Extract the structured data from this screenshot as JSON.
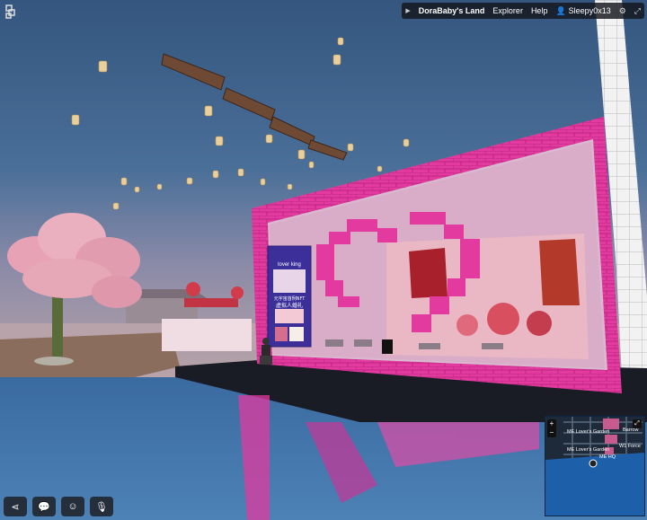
{
  "topbar": {
    "land_name": "DoraBaby's Land",
    "explorer_label": "Explorer",
    "help_label": "Help",
    "username": "Sleepy0x13"
  },
  "poster": {
    "line1": "lover king",
    "line2": "元宇宙首例NFT",
    "line3": "虚拟人婚礼"
  },
  "minimap": {
    "labels": [
      "ME Lover's Garden",
      "ME Lover's Garden",
      "ME HQ",
      "Barrow",
      "W1 Force"
    ]
  },
  "colors": {
    "sky_top": "#3a5b86",
    "sky_horizon": "#9c8fa8",
    "frame_pink": "#e0349c",
    "water": "#3f6fa1",
    "blossom": "#e9a6b6"
  }
}
